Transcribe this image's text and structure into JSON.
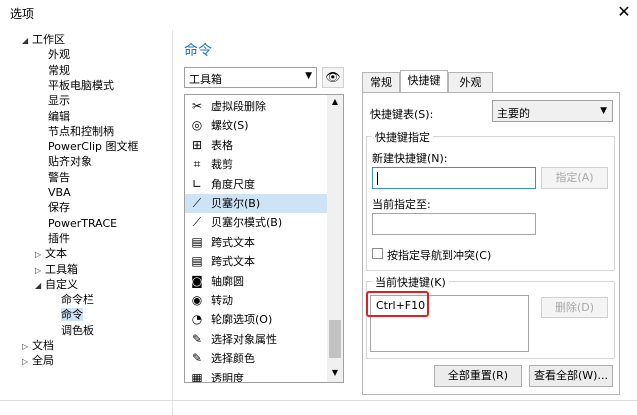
{
  "window": {
    "title": "选项",
    "close_glyph": "✕"
  },
  "tree": [
    {
      "label": "工作区",
      "arrow": "◢",
      "indent": 0
    },
    {
      "label": "外观",
      "indent": 2
    },
    {
      "label": "常规",
      "indent": 2
    },
    {
      "label": "平板电脑模式",
      "indent": 2
    },
    {
      "label": "显示",
      "indent": 2
    },
    {
      "label": "编辑",
      "indent": 2
    },
    {
      "label": "节点和控制柄",
      "indent": 2
    },
    {
      "label": "PowerClip 图文框",
      "indent": 2
    },
    {
      "label": "贴齐对象",
      "indent": 2
    },
    {
      "label": "警告",
      "indent": 2
    },
    {
      "label": "VBA",
      "indent": 2
    },
    {
      "label": "保存",
      "indent": 2
    },
    {
      "label": "PowerTRACE",
      "indent": 2
    },
    {
      "label": "插件",
      "indent": 2
    },
    {
      "label": "文本",
      "arrow": "▷",
      "indent": 1
    },
    {
      "label": "工具箱",
      "arrow": "▷",
      "indent": 1
    },
    {
      "label": "自定义",
      "arrow": "◢",
      "indent": 1
    },
    {
      "label": "命令栏",
      "indent": 3
    },
    {
      "label": "命令",
      "indent": 3,
      "selected": true
    },
    {
      "label": "调色板",
      "indent": 3
    },
    {
      "label": "文档",
      "arrow": "▷",
      "indent": 0
    },
    {
      "label": "全局",
      "arrow": "▷",
      "indent": 0
    }
  ],
  "heading": "命令",
  "category": {
    "value": "工具箱"
  },
  "commands": [
    {
      "label": "虚拟段删除",
      "icon": "virtual-segment-delete-icon",
      "glyph": "✂"
    },
    {
      "label": "螺纹(S)",
      "icon": "spiral-icon",
      "glyph": "◎"
    },
    {
      "label": "表格",
      "icon": "table-icon",
      "glyph": "⊞"
    },
    {
      "label": "裁剪",
      "icon": "crop-icon",
      "glyph": "⌗"
    },
    {
      "label": "角度尺度",
      "icon": "angle-dimension-icon",
      "glyph": "∟"
    },
    {
      "label": "贝塞尔(B)",
      "icon": "bezier-icon",
      "glyph": "⟋",
      "selected": true
    },
    {
      "label": "贝塞尔模式(B)",
      "icon": "bezier-mode-icon",
      "glyph": "⟋"
    },
    {
      "label": "跨式文本",
      "icon": "straddle-text-icon",
      "glyph": "▤"
    },
    {
      "label": "跨式文本",
      "icon": "straddle-text-icon-2",
      "glyph": "▤"
    },
    {
      "label": "轴廓圆",
      "icon": "contour-circle-icon",
      "glyph": "◙"
    },
    {
      "label": "转动",
      "icon": "rotate-icon",
      "glyph": "◉"
    },
    {
      "label": "轮廓选项(O)",
      "icon": "outline-options-icon",
      "glyph": "◔"
    },
    {
      "label": "选择对象属性",
      "icon": "eyedropper-object-icon",
      "glyph": "✎"
    },
    {
      "label": "选择颜色",
      "icon": "eyedropper-color-icon",
      "glyph": "✎"
    },
    {
      "label": "透明度",
      "icon": "transparency-icon",
      "glyph": "▦"
    }
  ],
  "tabs": [
    "常规",
    "快捷键",
    "外观"
  ],
  "active_tab": 1,
  "shortcuts": {
    "table_label": "快捷键表(S):",
    "table_value": "主要的",
    "assign_group": "快捷键指定",
    "new_key_label": "新建快捷键(N):",
    "assign_button": "指定(A)",
    "current_assigned_label": "当前指定至:",
    "nav_checkbox": "按指定导航到冲突(C)",
    "current_group": "当前快捷键(K)",
    "current_value": "Ctrl+F10",
    "delete_button": "删除(D)",
    "reset_all_button": "全部重置(R)",
    "view_all_button": "查看全部(W)..."
  }
}
